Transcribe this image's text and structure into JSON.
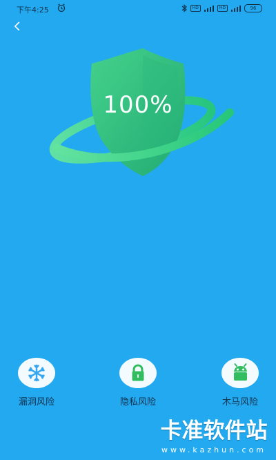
{
  "status": {
    "time": "下午4:25",
    "hd1": "HD",
    "hd2": "HD",
    "battery": "96"
  },
  "shield": {
    "percent": "100%"
  },
  "features": [
    {
      "label": "漏洞风险",
      "icon": "snowflake-icon"
    },
    {
      "label": "隐私风险",
      "icon": "lock-icon"
    },
    {
      "label": "木马风险",
      "icon": "android-icon"
    }
  ],
  "watermark": {
    "title": "卡准软件站",
    "url": "www.kazhun.com"
  },
  "colors": {
    "background": "#22a9f0",
    "shield": "#2fbf84",
    "ring": "#27c27b",
    "accent_green": "#33bd61",
    "text_dark": "#143552"
  }
}
